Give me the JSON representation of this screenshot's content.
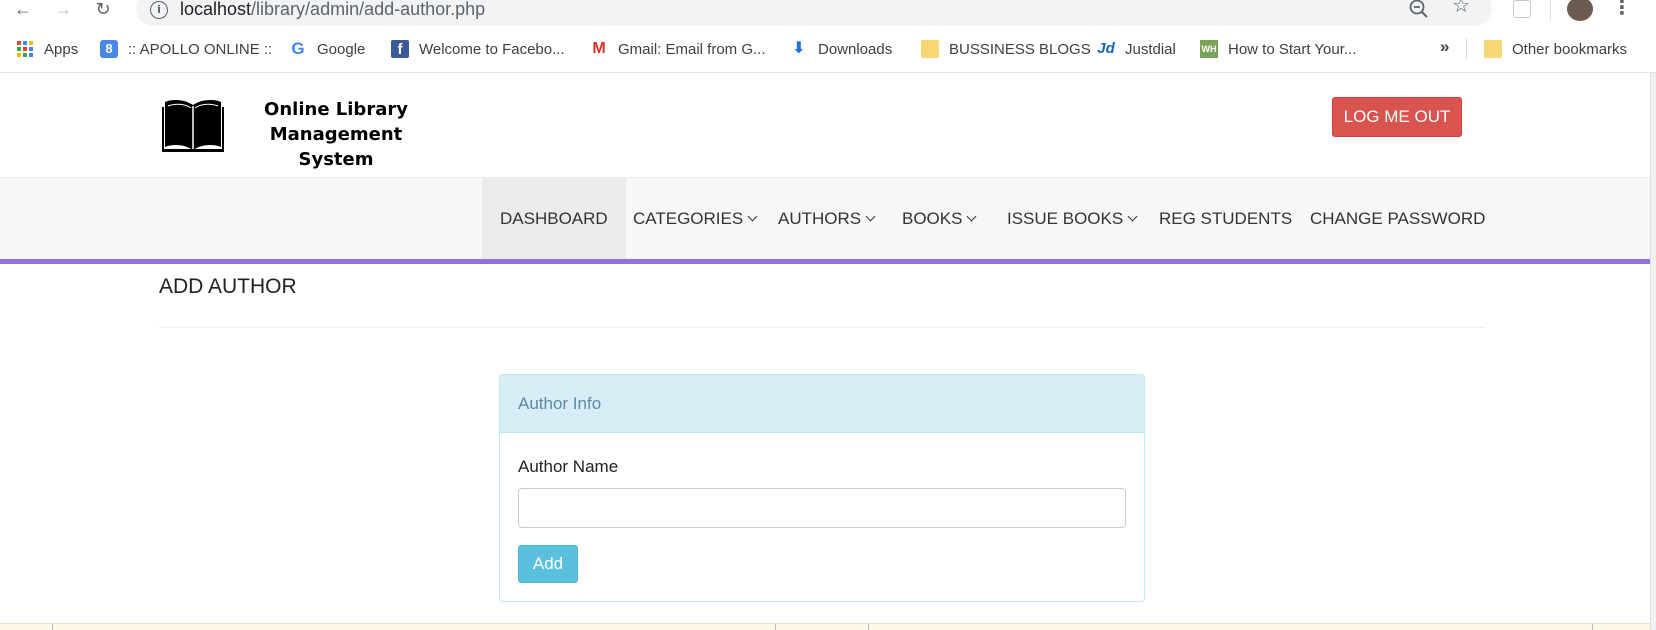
{
  "browser": {
    "url_host": "localhost",
    "url_path": "/library/admin/add-author.php",
    "bookmarks": [
      {
        "label": "Apps",
        "icon": "apps-grid-icon"
      },
      {
        "label": ":: APOLLO ONLINE ::",
        "icon": "apollo-icon"
      },
      {
        "label": "Google",
        "icon": "google-icon"
      },
      {
        "label": "Welcome to Facebo...",
        "icon": "facebook-icon"
      },
      {
        "label": "Gmail: Email from G...",
        "icon": "gmail-icon"
      },
      {
        "label": "Downloads",
        "icon": "download-icon"
      },
      {
        "label": "BUSSINESS BLOGS",
        "icon": "folder-icon"
      },
      {
        "label": "Justdial",
        "icon": "justdial-icon"
      },
      {
        "label": "How to Start Your...",
        "icon": "wikihow-icon"
      }
    ],
    "more_label": "»",
    "other_bookmarks": "Other bookmarks"
  },
  "header": {
    "logo_line1": "Online Library",
    "logo_line2": "Management System",
    "logout_label": "LOG ME OUT"
  },
  "menu": [
    {
      "label": "DASHBOARD",
      "dropdown": false,
      "active": true
    },
    {
      "label": "CATEGORIES",
      "dropdown": true,
      "active": false
    },
    {
      "label": "AUTHORS",
      "dropdown": true,
      "active": false
    },
    {
      "label": "BOOKS",
      "dropdown": true,
      "active": false
    },
    {
      "label": "ISSUE BOOKS",
      "dropdown": true,
      "active": false
    },
    {
      "label": "REG STUDENTS",
      "dropdown": false,
      "active": false
    },
    {
      "label": "CHANGE PASSWORD",
      "dropdown": false,
      "active": false
    }
  ],
  "page": {
    "title": "ADD AUTHOR",
    "panel_heading": "Author Info",
    "field_label": "Author Name",
    "field_value": "",
    "submit_label": "Add"
  },
  "colors": {
    "accent": "#9170e0",
    "logout": "#d9534f",
    "add_button": "#5bc0de",
    "panel_heading_bg": "#d9edf7"
  }
}
